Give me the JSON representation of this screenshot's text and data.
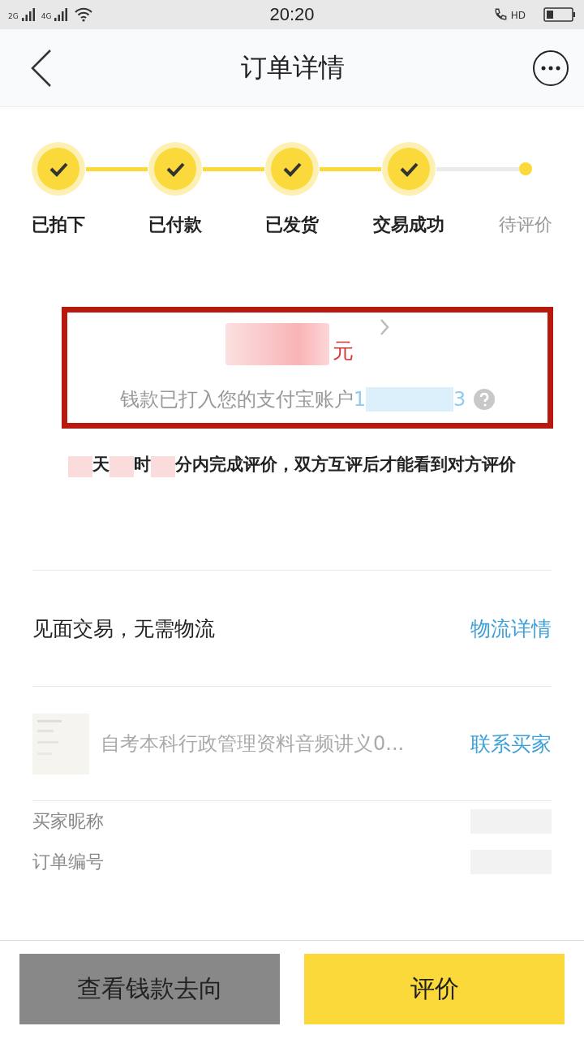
{
  "status_bar": {
    "network_1": "2G",
    "network_2": "4G",
    "time": "20:20",
    "call_badge": "HD"
  },
  "nav": {
    "title": "订单详情"
  },
  "steps": [
    {
      "label": "已拍下",
      "done": true
    },
    {
      "label": "已付款",
      "done": true
    },
    {
      "label": "已发货",
      "done": true
    },
    {
      "label": "交易成功",
      "done": true
    },
    {
      "label": "待评价",
      "done": false
    }
  ],
  "amount": {
    "unit": "元",
    "note": "钱款已打入您的支付宝账户",
    "account_first": "1",
    "account_last": "3",
    "highlighted": true
  },
  "countdown": {
    "day_unit": "天",
    "hour_unit": "时",
    "rest": "分内完成评价，双方互评后才能看到对方评价"
  },
  "delivery": {
    "text": "见面交易，无需物流",
    "link": "物流详情"
  },
  "item": {
    "title": "自考本科行政管理资料音频讲义0...",
    "link": "联系买家"
  },
  "info": [
    {
      "label": "买家昵称"
    },
    {
      "label": "订单编号"
    }
  ],
  "buttons": [
    {
      "label": "查看钱款去向",
      "kind": "secondary"
    },
    {
      "label": "评价",
      "kind": "primary"
    }
  ]
}
